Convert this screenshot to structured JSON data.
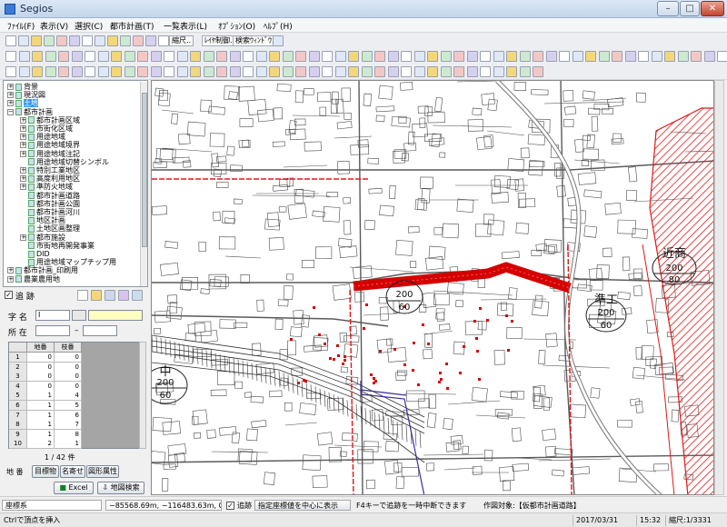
{
  "window": {
    "title": "Segios",
    "btn_min": "–",
    "btn_max": "□",
    "btn_close": "✕"
  },
  "menu": [
    "ﾌｧｲﾙ(F)",
    "表示(V)",
    "選択(C)",
    "都市計画(T)",
    "一覧表示(L)",
    "ｵﾌﾟｼｮﾝ(O)",
    "ﾍﾙﾌﾟ(H)"
  ],
  "toolbar1": {
    "scale_label": "縮尺..",
    "layer_label": "ﾚｲﾔ制御..",
    "search_label": "検索ｳｨﾝﾄﾞｳ.."
  },
  "tree": [
    {
      "label": "背景",
      "exp": "+",
      "indent": 0
    },
    {
      "label": "現況図",
      "exp": "+",
      "indent": 0
    },
    {
      "label": "土地",
      "exp": "+",
      "indent": 0,
      "selected": true
    },
    {
      "label": "都市計画",
      "exp": "−",
      "indent": 0
    },
    {
      "label": "都市計画区域",
      "exp": "+",
      "indent": 1
    },
    {
      "label": "市街化区域",
      "exp": "+",
      "indent": 1
    },
    {
      "label": "用途地域",
      "exp": "+",
      "indent": 1
    },
    {
      "label": "用途地域境界",
      "exp": "+",
      "indent": 1
    },
    {
      "label": "用途地域注記",
      "exp": "+",
      "indent": 1
    },
    {
      "label": "用途地域切替シンボル",
      "exp": "",
      "indent": 1
    },
    {
      "label": "特別工業地区",
      "exp": "+",
      "indent": 1
    },
    {
      "label": "高度利用地区",
      "exp": "+",
      "indent": 1
    },
    {
      "label": "準防火地域",
      "exp": "+",
      "indent": 1
    },
    {
      "label": "都市計画道路",
      "exp": "",
      "indent": 1
    },
    {
      "label": "都市計画公園",
      "exp": "",
      "indent": 1
    },
    {
      "label": "都市計画河川",
      "exp": "",
      "indent": 1
    },
    {
      "label": "地区計画",
      "exp": "",
      "indent": 1
    },
    {
      "label": "土地区画整理",
      "exp": "",
      "indent": 1
    },
    {
      "label": "都市施設",
      "exp": "+",
      "indent": 1
    },
    {
      "label": "市街地再開発事業",
      "exp": "",
      "indent": 1
    },
    {
      "label": "DID",
      "exp": "",
      "indent": 1
    },
    {
      "label": "用途地域マップチップ用",
      "exp": "",
      "indent": 1
    },
    {
      "label": "都市計画_印刷用",
      "exp": "+",
      "indent": 0
    },
    {
      "label": "農業農用地",
      "exp": "+",
      "indent": 0
    }
  ],
  "search": {
    "checkbox_label": "追 跡"
  },
  "form": {
    "aza_label": "字 名",
    "aza_value": "I",
    "shozai_label": "所 在",
    "dash": "–",
    "col_chiban": "地番",
    "col_edaban": "枝番",
    "rows": [
      {
        "n": "1",
        "a": "0",
        "b": "0"
      },
      {
        "n": "2",
        "a": "0",
        "b": "0"
      },
      {
        "n": "3",
        "a": "0",
        "b": "0"
      },
      {
        "n": "4",
        "a": "0",
        "b": "0"
      },
      {
        "n": "5",
        "a": "1",
        "b": "4"
      },
      {
        "n": "6",
        "a": "1",
        "b": "5"
      },
      {
        "n": "7",
        "a": "1",
        "b": "6"
      },
      {
        "n": "8",
        "a": "1",
        "b": "7"
      },
      {
        "n": "9",
        "a": "1",
        "b": "8"
      },
      {
        "n": "10",
        "a": "2",
        "b": "1"
      }
    ],
    "count": "1 / 42 件",
    "tab_chiban": "地 番",
    "tab_mokuteki": "目標物",
    "tab_meiyose": "名寄せ",
    "tab_zukei": "図形属性",
    "excel_btn": "Excel",
    "map_search_btn": "地図検索"
  },
  "map_labels": {
    "zone1_a": "200",
    "zone1_b": "60",
    "zone2_title": "準工",
    "zone2_a": "200",
    "zone2_b": "60",
    "zone3_title": "近商",
    "zone3_a": "200",
    "zone3_b": "80",
    "zone4_title": "中",
    "zone4_a": "200",
    "zone4_b": "60"
  },
  "status": {
    "coord_sys": "座標系",
    "coords": "−85568.69m,  −116483.63m,  0.00m",
    "track_label": "追跡",
    "center_btn": "指定座標値を中心に表示",
    "hint": "F4キーで追跡を一時中断できます",
    "target": "作図対象:【仮都市計画道路】",
    "date": "2017/03/31",
    "time": "15:32",
    "scale": "縮尺:1/3331",
    "ctrl_hint": "Ctrlで頂点を挿入"
  },
  "colors": {
    "road_highlight": "#d40000",
    "zone_hatch": "#e01818",
    "map_line": "#3a3a3a"
  }
}
